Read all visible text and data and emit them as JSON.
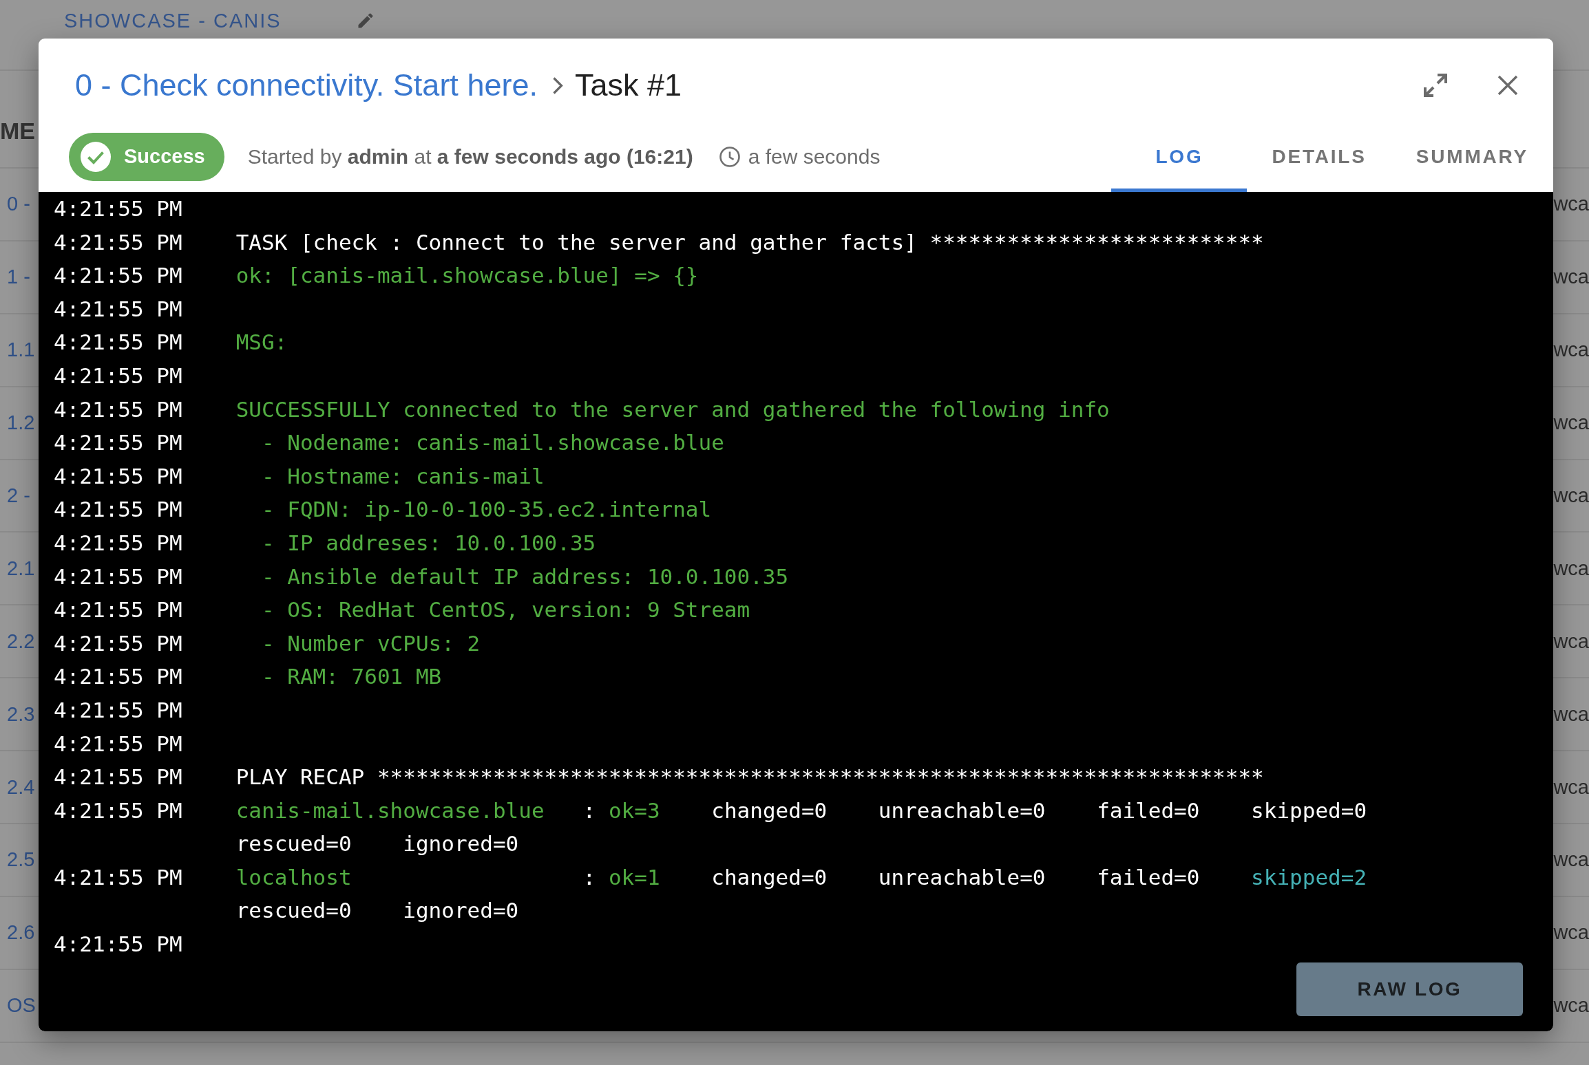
{
  "background_page": {
    "title": "SHOWCASE - CANIS",
    "table": {
      "columns": [
        "ME"
      ],
      "rows": [
        {
          "cells": [
            "0 -",
            "wca"
          ]
        },
        {
          "cells": [
            "1 -",
            "wca"
          ]
        },
        {
          "cells": [
            "1.1",
            "wca"
          ]
        },
        {
          "cells": [
            "1.2",
            "wca"
          ]
        },
        {
          "cells": [
            "2 -",
            "wca"
          ]
        },
        {
          "cells": [
            "2.1",
            "wca"
          ]
        },
        {
          "cells": [
            "2.2",
            "wca"
          ]
        },
        {
          "cells": [
            "2.3",
            "wca"
          ]
        },
        {
          "cells": [
            "2.4",
            "wca"
          ]
        },
        {
          "cells": [
            "2.5",
            "wca"
          ]
        },
        {
          "cells": [
            "2.6",
            "wca"
          ]
        },
        {
          "cells": [
            "OS",
            "wca"
          ]
        }
      ]
    }
  },
  "dialog": {
    "breadcrumb": {
      "parent": "0 - Check connectivity. Start here.",
      "current": "Task #1"
    },
    "status": {
      "kind": "success",
      "label": "Success"
    },
    "started": "Started by **admin** at **a few seconds ago (16:21)**",
    "duration": "a few seconds",
    "tabs": [
      {
        "label": "LOG",
        "selected": true
      },
      {
        "label": "DETAILS",
        "selected": false
      },
      {
        "label": "SUMMARY",
        "selected": false
      }
    ],
    "log": {
      "lines": [
        {
          "time": "4:21:55 PM"
        },
        {
          "time": "4:21:55 PM",
          "segments": [
            {
              "text": "TASK [check : Connect to the server and gather facts] **************************",
              "color": "#ffffff"
            }
          ]
        },
        {
          "time": "4:21:55 PM",
          "segments": [
            {
              "text": "ok: [canis-mail.showcase.blue] => {}",
              "color": "#52ad42"
            }
          ]
        },
        {
          "time": "4:21:55 PM"
        },
        {
          "time": "4:21:55 PM",
          "segments": [
            {
              "text": "MSG:",
              "color": "#52ad42"
            }
          ]
        },
        {
          "time": "4:21:55 PM"
        },
        {
          "time": "4:21:55 PM",
          "segments": [
            {
              "text": "SUCCESSFULLY connected to the server and gathered the following info",
              "color": "#52ad42"
            }
          ]
        },
        {
          "time": "4:21:55 PM",
          "segments": [
            {
              "text": "  - Nodename: canis-mail.showcase.blue",
              "color": "#52ad42"
            }
          ]
        },
        {
          "time": "4:21:55 PM",
          "segments": [
            {
              "text": "  - Hostname: canis-mail",
              "color": "#52ad42"
            }
          ]
        },
        {
          "time": "4:21:55 PM",
          "segments": [
            {
              "text": "  - FQDN: ip-10-0-100-35.ec2.internal",
              "color": "#52ad42"
            }
          ]
        },
        {
          "time": "4:21:55 PM",
          "segments": [
            {
              "text": "  - IP addreses: 10.0.100.35",
              "color": "#52ad42"
            }
          ]
        },
        {
          "time": "4:21:55 PM",
          "segments": [
            {
              "text": "  - Ansible default IP address: 10.0.100.35",
              "color": "#52ad42"
            }
          ]
        },
        {
          "time": "4:21:55 PM",
          "segments": [
            {
              "text": "  - OS: RedHat CentOS, version: 9 Stream",
              "color": "#52ad42"
            }
          ]
        },
        {
          "time": "4:21:55 PM",
          "segments": [
            {
              "text": "  - Number vCPUs: 2",
              "color": "#52ad42"
            }
          ]
        },
        {
          "time": "4:21:55 PM",
          "segments": [
            {
              "text": "  - RAM: 7601 MB",
              "color": "#52ad42"
            }
          ]
        },
        {
          "time": "4:21:55 PM"
        },
        {
          "time": "4:21:55 PM"
        },
        {
          "time": "4:21:55 PM",
          "segments": [
            {
              "text": "PLAY RECAP *********************************************************************",
              "color": "#ffffff"
            }
          ]
        },
        {
          "time": "4:21:55 PM",
          "segments": [
            {
              "text": "canis-mail.showcase.blue",
              "color": "#52ad42"
            },
            {
              "text": "   :",
              "color": "#ffffff"
            },
            {
              "text": " ok=3",
              "color": "#52ad42"
            },
            {
              "text": "    changed=0    unreachable=0    failed=0    skipped=0",
              "color": "#ffffff"
            },
            {
              "text": "    rescued=0    ignored=0",
              "color": "#ffffff"
            }
          ]
        },
        {
          "time": "4:21:55 PM",
          "segments": [
            {
              "text": "localhost",
              "color": "#52ad42"
            },
            {
              "text": "                  :",
              "color": "#ffffff"
            },
            {
              "text": " ok=1",
              "color": "#52ad42"
            },
            {
              "text": "    changed=0    unreachable=0    failed=0",
              "color": "#ffffff"
            },
            {
              "text": "    skipped=2",
              "color": "#45b1b5"
            },
            {
              "text": "    rescued=0    ignored=0",
              "color": "#ffffff"
            }
          ]
        },
        {
          "time": "4:21:55 PM"
        }
      ]
    },
    "raw_log_button": {
      "label": "RAW LOG"
    }
  }
}
